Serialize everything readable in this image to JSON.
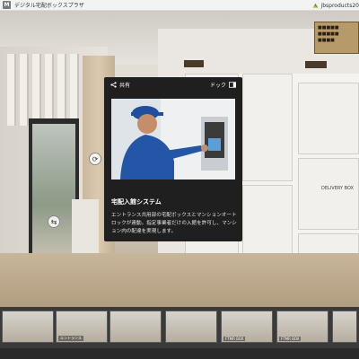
{
  "app": {
    "title": "デジタル宅配ボックスプラザ",
    "logo_text": "M",
    "link_text": "jbsproducts20"
  },
  "scene": {
    "plate_text": "■■■■■\n■■■■■\n■■■■",
    "delivery_label": "DELIVERY BOX"
  },
  "popup": {
    "share_label": "共有",
    "dock_label": "ドック",
    "title": "宅配入館システム",
    "description": "エントランス共用部の宅配ボックスとマンションオートロックが連動。指定事業者だけの入館を許可し、マンション内の配達を実現します。"
  },
  "hotspots": [
    {
      "name": "rotate-hotspot",
      "glyph": "⟳"
    },
    {
      "name": "nav-hotspot",
      "glyph": "⇆"
    }
  ],
  "thumbnails": [
    {
      "label": ""
    },
    {
      "label": "エントランス"
    },
    {
      "label": ""
    },
    {
      "label": ""
    },
    {
      "label": "FTMR BOX"
    },
    {
      "label": "FTMR BOX"
    },
    {
      "label": ""
    }
  ]
}
